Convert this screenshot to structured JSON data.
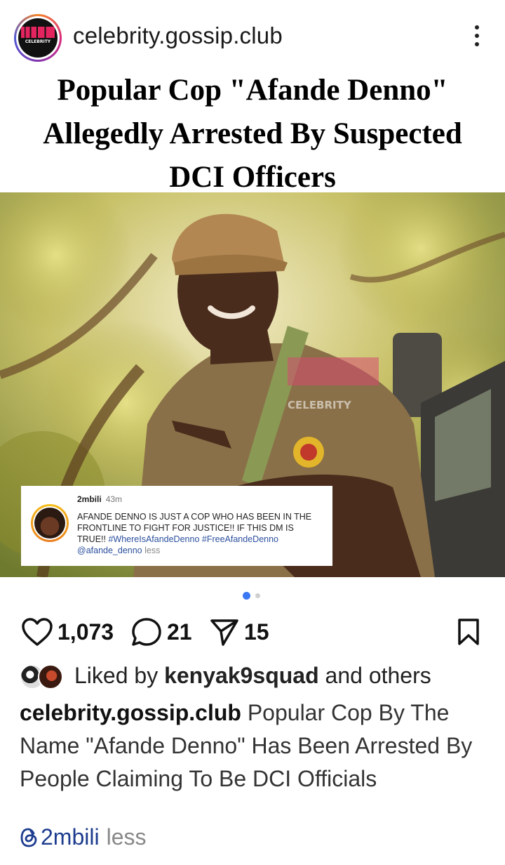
{
  "header": {
    "username": "celebrity.gossip.club",
    "logo_text_top": "CELEBRITY",
    "logo_text_mid": "G SSIP",
    "logo_text_bottom": "CLUB"
  },
  "headline": {
    "line1": "Popular Cop \"Afande Denno\"",
    "line2": "Allegedly Arrested By Suspected",
    "line3": "DCI Officers"
  },
  "photo": {
    "watermark": "CELEBRITY"
  },
  "comment": {
    "username": "2mbili",
    "time": "43m",
    "text": "AFANDE DENNO IS JUST A COP WHO HAS BEEN IN THE FRONTLINE TO FIGHT FOR JUSTICE!! IF THIS DM IS TRUE!! ",
    "hashtag1": "#WhereIsAfandeDenno",
    "hashtag2": "#FreeAfandeDenno",
    "mention": "@afande_denno",
    "less": "less"
  },
  "carousel": {
    "total": 2,
    "active_index": 0
  },
  "actions": {
    "likes_count": "1,073",
    "comments_count": "21",
    "shares_count": "15"
  },
  "likes": {
    "prefix": "Liked by",
    "user": "kenyak9squad",
    "suffix": "and others"
  },
  "caption": {
    "username": "celebrity.gossip.club",
    "text": "Popular Cop By The Name \"Afande Denno\" Has Been Arrested By People Claiming To Be DCI Officials"
  },
  "threads": {
    "handle": "2mbili",
    "less": "less"
  },
  "colors": {
    "link": "#1d3c8f",
    "hashtag": "#2b4f9e",
    "dot_active": "#3a77f2"
  },
  "icons": {
    "more": "more-vertical-icon",
    "like": "heart-icon",
    "comment": "comment-bubble-icon",
    "share": "paper-plane-icon",
    "save": "bookmark-icon",
    "threads": "threads-icon"
  }
}
